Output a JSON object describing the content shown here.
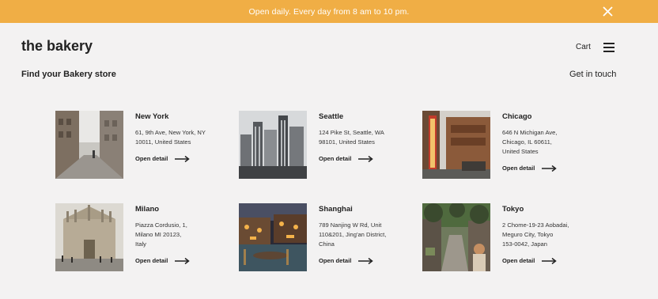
{
  "banner": {
    "text": "Open daily. Every day from 8 am to 10 pm.",
    "close_icon": "close-icon"
  },
  "header": {
    "logo": "the bakery",
    "cart_label": "Cart",
    "menu_icon": "hamburger-menu-icon"
  },
  "page": {
    "title": "Find your Bakery store",
    "contact_label": "Get in touch"
  },
  "stores": [
    {
      "name": "New York",
      "address_lines": [
        "61, 9th Ave, New York, NY",
        "10011, United States"
      ],
      "link_label": "Open detail"
    },
    {
      "name": "Seattle",
      "address_lines": [
        "124 Pike St, Seattle, WA",
        "98101, United States"
      ],
      "link_label": "Open detail"
    },
    {
      "name": "Chicago",
      "address_lines": [
        "646 N Michigan Ave,",
        "Chicago, IL 60611,",
        "United States"
      ],
      "link_label": "Open detail"
    },
    {
      "name": "Milano",
      "address_lines": [
        "Piazza Cordusio, 1,",
        "Milano MI 20123,",
        "Italy"
      ],
      "link_label": "Open detail"
    },
    {
      "name": "Shanghai",
      "address_lines": [
        "789 Nanjing W Rd, Unit",
        "110&201, Jing'an District,",
        "China"
      ],
      "link_label": "Open detail"
    },
    {
      "name": "Tokyo",
      "address_lines": [
        "2 Chome-19-23 Aobadai,",
        "Meguro City, Tokyo",
        "153-0042, Japan"
      ],
      "link_label": "Open detail"
    }
  ],
  "colors": {
    "banner": "#f0ae45",
    "background": "#f3f2f2",
    "text": "#222222"
  }
}
